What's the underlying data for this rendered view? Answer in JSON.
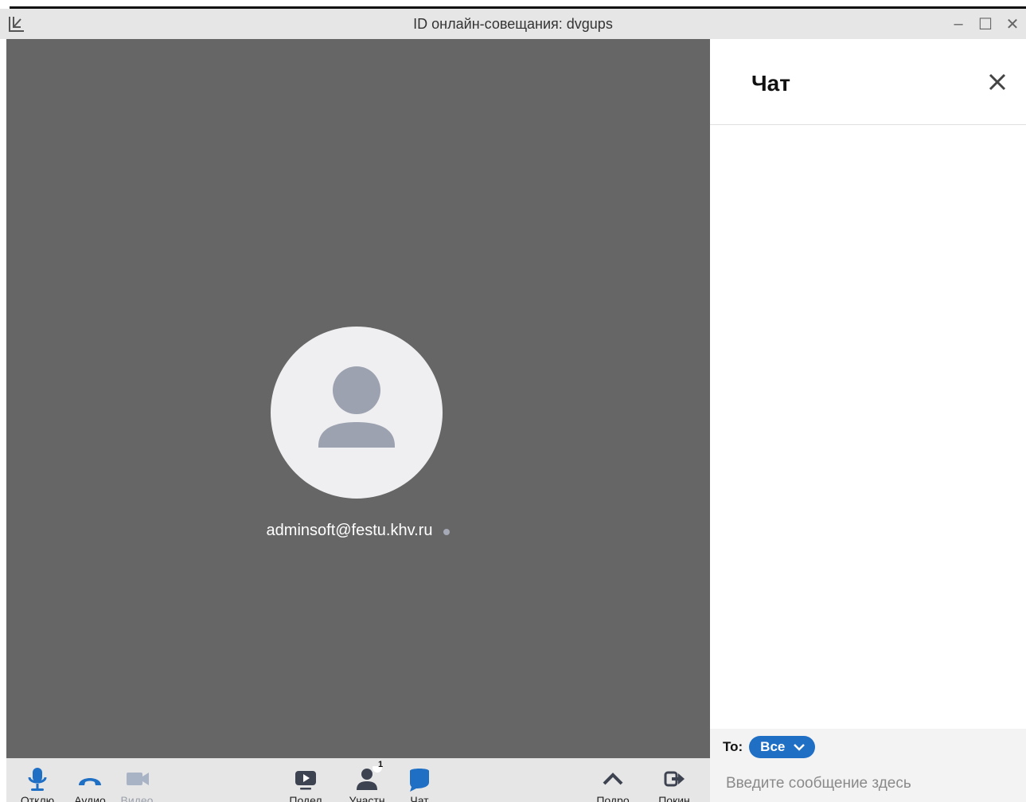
{
  "window": {
    "title": "ID онлайн-совещания: dvgups",
    "controls": {
      "minimize": "–",
      "maximize": "☐",
      "close": "✕"
    }
  },
  "video": {
    "participant_name": "adminsoft@festu.khv.ru",
    "background_color": "#666666"
  },
  "toolbar": {
    "items": [
      {
        "label": "Отклю",
        "icon": "microphone-icon"
      },
      {
        "label": "Аудио",
        "icon": "phone-icon"
      },
      {
        "label": "Видео",
        "icon": "video-camera-icon"
      },
      {
        "label": "Подел",
        "icon": "share-screen-icon"
      },
      {
        "label": "Участн",
        "icon": "participants-icon",
        "badge": "1"
      },
      {
        "label": "Чат",
        "icon": "chat-icon"
      },
      {
        "label": "Подро",
        "icon": "chevron-up-icon"
      },
      {
        "label": "Покин",
        "icon": "leave-icon"
      }
    ]
  },
  "chat": {
    "title": "Чат",
    "to_label": "To:",
    "recipient": "Все",
    "input_placeholder": "Введите сообщение здесь",
    "accent_color": "#1f6fc5"
  }
}
